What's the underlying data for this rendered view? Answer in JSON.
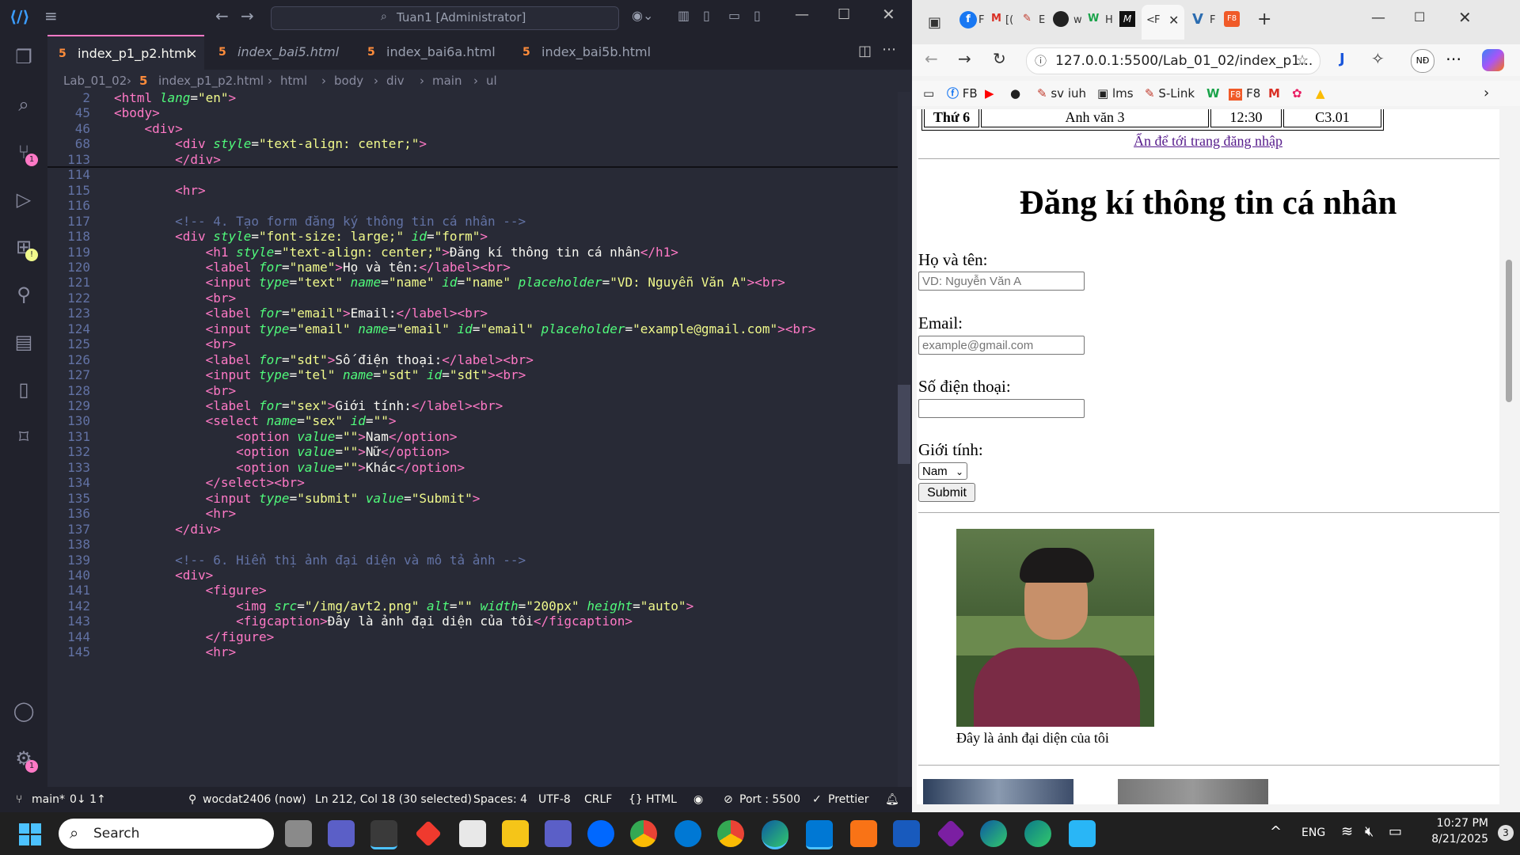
{
  "vscode": {
    "search_text": "Tuan1 [Administrator]",
    "tabs": [
      {
        "label": "index_p1_p2.html",
        "active": true
      },
      {
        "label": "index_bai5.html",
        "active": false
      },
      {
        "label": "index_bai6a.html",
        "active": false
      },
      {
        "label": "index_bai5b.html",
        "active": false
      }
    ],
    "tab_close": "×",
    "breadcrumb": [
      "Lab_01_02",
      "index_p1_p2.html",
      "html",
      "body",
      "div",
      "main",
      "ul"
    ],
    "sticky_lines": [
      {
        "num": "2",
        "html": "<span class='t'>&lt;html</span> <span class='a'>lang</span>=<span class='s'>\"en\"</span><span class='t'>&gt;</span>"
      },
      {
        "num": "45",
        "html": "<span class='t'>&lt;body&gt;</span>"
      },
      {
        "num": "46",
        "html": "    <span class='t'>&lt;div&gt;</span>"
      },
      {
        "num": "68",
        "html": "        <span class='t'>&lt;div</span> <span class='a'>style</span>=<span class='s'>\"text-align: center;\"</span><span class='t'>&gt;</span>"
      }
    ],
    "lines": [
      {
        "num": "113",
        "html": "        <span class='t'>&lt;/div&gt;</span>"
      },
      {
        "num": "114",
        "html": ""
      },
      {
        "num": "115",
        "html": "        <span class='t'>&lt;hr&gt;</span>"
      },
      {
        "num": "116",
        "html": ""
      },
      {
        "num": "117",
        "html": "        <span class='c'>&lt;!-- 4. Tạo form đăng ký thông tin cá nhân --&gt;</span>"
      },
      {
        "num": "118",
        "html": "        <span class='t'>&lt;div</span> <span class='a'>style</span>=<span class='s'>\"font-size: large;\"</span> <span class='a'>id</span>=<span class='s'>\"form\"</span><span class='t'>&gt;</span>"
      },
      {
        "num": "119",
        "html": "            <span class='t'>&lt;h1</span> <span class='a'>style</span>=<span class='s'>\"text-align: center;\"</span><span class='t'>&gt;</span>Đăng kí thông tin cá nhân<span class='t'>&lt;/h1&gt;</span>"
      },
      {
        "num": "120",
        "html": "            <span class='t'>&lt;label</span> <span class='a'>for</span>=<span class='s'>\"name\"</span><span class='t'>&gt;</span>Họ và tên:<span class='t'>&lt;/label&gt;&lt;br&gt;</span>"
      },
      {
        "num": "121",
        "html": "            <span class='t'>&lt;input</span> <span class='a'>type</span>=<span class='s'>\"text\"</span> <span class='a'>name</span>=<span class='s'>\"name\"</span> <span class='a'>id</span>=<span class='s'>\"name\"</span> <span class='a'>placeholder</span>=<span class='s'>\"VD: Nguyễn Văn A\"</span><span class='t'>&gt;&lt;br&gt;</span>"
      },
      {
        "num": "122",
        "html": "            <span class='t'>&lt;br&gt;</span>"
      },
      {
        "num": "123",
        "html": "            <span class='t'>&lt;label</span> <span class='a'>for</span>=<span class='s'>\"email\"</span><span class='t'>&gt;</span>Email:<span class='t'>&lt;/label&gt;&lt;br&gt;</span>"
      },
      {
        "num": "124",
        "html": "            <span class='t'>&lt;input</span> <span class='a'>type</span>=<span class='s'>\"email\"</span> <span class='a'>name</span>=<span class='s'>\"email\"</span> <span class='a'>id</span>=<span class='s'>\"email\"</span> <span class='a'>placeholder</span>=<span class='s'>\"example@gmail.com\"</span><span class='t'>&gt;&lt;br&gt;</span>"
      },
      {
        "num": "125",
        "html": "            <span class='t'>&lt;br&gt;</span>"
      },
      {
        "num": "126",
        "html": "            <span class='t'>&lt;label</span> <span class='a'>for</span>=<span class='s'>\"sdt\"</span><span class='t'>&gt;</span>Số điện thoại:<span class='t'>&lt;/label&gt;&lt;br&gt;</span>"
      },
      {
        "num": "127",
        "html": "            <span class='t'>&lt;input</span> <span class='a'>type</span>=<span class='s'>\"tel\"</span> <span class='a'>name</span>=<span class='s'>\"sdt\"</span> <span class='a'>id</span>=<span class='s'>\"sdt\"</span><span class='t'>&gt;&lt;br&gt;</span>"
      },
      {
        "num": "128",
        "html": "            <span class='t'>&lt;br&gt;</span>"
      },
      {
        "num": "129",
        "html": "            <span class='t'>&lt;label</span> <span class='a'>for</span>=<span class='s'>\"sex\"</span><span class='t'>&gt;</span>Giới tính:<span class='t'>&lt;/label&gt;&lt;br&gt;</span>"
      },
      {
        "num": "130",
        "html": "            <span class='t'>&lt;select</span> <span class='a'>name</span>=<span class='s'>\"sex\"</span> <span class='a'>id</span>=<span class='s'>\"\"</span><span class='t'>&gt;</span>"
      },
      {
        "num": "131",
        "html": "                <span class='t'>&lt;option</span> <span class='a'>value</span>=<span class='s'>\"\"</span><span class='t'>&gt;</span>Nam<span class='t'>&lt;/option&gt;</span>"
      },
      {
        "num": "132",
        "html": "                <span class='t'>&lt;option</span> <span class='a'>value</span>=<span class='s'>\"\"</span><span class='t'>&gt;</span>Nữ<span class='t'>&lt;/option&gt;</span>"
      },
      {
        "num": "133",
        "html": "                <span class='t'>&lt;option</span> <span class='a'>value</span>=<span class='s'>\"\"</span><span class='t'>&gt;</span>Khác<span class='t'>&lt;/option&gt;</span>"
      },
      {
        "num": "134",
        "html": "            <span class='t'>&lt;/select&gt;&lt;br&gt;</span>"
      },
      {
        "num": "135",
        "html": "            <span class='t'>&lt;input</span> <span class='a'>type</span>=<span class='s'>\"submit\"</span> <span class='a'>value</span>=<span class='s'>\"Submit\"</span><span class='t'>&gt;</span>"
      },
      {
        "num": "136",
        "html": "            <span class='t'>&lt;hr&gt;</span>"
      },
      {
        "num": "137",
        "html": "        <span class='t'>&lt;/div&gt;</span>"
      },
      {
        "num": "138",
        "html": ""
      },
      {
        "num": "139",
        "html": "        <span class='c'>&lt;!-- 6. Hiển thị ảnh đại diện và mô tả ảnh --&gt;</span>"
      },
      {
        "num": "140",
        "html": "        <span class='t'>&lt;div&gt;</span>"
      },
      {
        "num": "141",
        "html": "            <span class='t'>&lt;figure&gt;</span>"
      },
      {
        "num": "142",
        "html": "                <span class='t'>&lt;img</span> <span class='a'>src</span>=<span class='s'>\"/img/avt2.png\"</span> <span class='a'>alt</span>=<span class='s'>\"\"</span> <span class='a'>width</span>=<span class='s'>\"200px\"</span> <span class='a'>height</span>=<span class='s'>\"auto\"</span><span class='t'>&gt;</span>"
      },
      {
        "num": "143",
        "html": "                <span class='t'>&lt;figcaption&gt;</span>Đây là ảnh đại diện của tôi<span class='t'>&lt;/figcaption&gt;</span>"
      },
      {
        "num": "144",
        "html": "            <span class='t'>&lt;/figure&gt;</span>"
      },
      {
        "num": "145",
        "html": "            <span class='t'>&lt;hr&gt;</span>"
      }
    ],
    "status": {
      "branch": "main*",
      "sync": "0↓ 1↑",
      "author": "wocdat2406 (now)",
      "position": "Ln 212, Col 18 (30 selected)",
      "spaces": "Spaces: 4",
      "encoding": "UTF-8",
      "eol": "CRLF",
      "language": "HTML",
      "port": "Port : 5500",
      "prettier": "Prettier"
    }
  },
  "browser": {
    "url": "127.0.0.1:5500/Lab_01_02/index_p1...",
    "profile": "NĐ",
    "bookmarks": [
      "FB",
      "sv iuh",
      "lms",
      "S-Link",
      "F8"
    ],
    "tab_labels": [
      "F",
      "[(",
      "E",
      "w",
      "H",
      "<",
      "F",
      "F"
    ],
    "page": {
      "table_row": [
        "Thứ 6",
        "Anh văn 3",
        "12:30",
        "C3.01"
      ],
      "login_link": "Ẩn để tới trang đăng nhập",
      "heading": "Đăng kí thông tin cá nhân",
      "name_label": "Họ và tên:",
      "name_placeholder": "VD: Nguyễn Văn A",
      "email_label": "Email:",
      "email_placeholder": "example@gmail.com",
      "phone_label": "Số điện thoại:",
      "sex_label": "Giới tính:",
      "sex_selected": "Nam",
      "submit": "Submit",
      "caption": "Đây là ảnh đại diện của tôi"
    }
  },
  "taskbar": {
    "search": "Search",
    "lang": "ENG",
    "time": "10:27 PM",
    "date": "8/21/2025",
    "notif": "3"
  },
  "colors": {
    "accent": "#ff79c6",
    "editor_bg": "#282a36",
    "taskbar": "#202020"
  }
}
